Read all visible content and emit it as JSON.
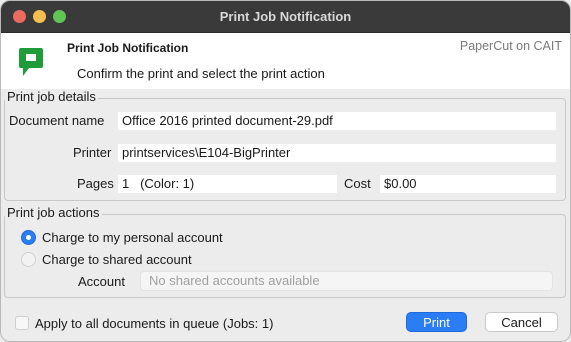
{
  "window": {
    "title": "Print Job Notification"
  },
  "header": {
    "title": "Print Job Notification",
    "brand": "PaperCut on CAIT",
    "subtitle": "Confirm the print and select the print action",
    "logo_color": "#1f9c3a"
  },
  "details": {
    "legend": "Print job details",
    "document_label": "Document name",
    "document_value": "Office 2016 printed document-29.pdf",
    "printer_label": "Printer",
    "printer_value": "printservices\\E104-BigPrinter",
    "pages_label": "Pages",
    "pages_value": "1   (Color: 1)",
    "cost_label": "Cost",
    "cost_value": "$0.00"
  },
  "actions": {
    "legend": "Print job actions",
    "personal_label": "Charge to my personal account",
    "personal_selected": true,
    "shared_label": "Charge to shared account",
    "shared_selected": false,
    "account_label": "Account",
    "account_placeholder": "No shared accounts available"
  },
  "footer": {
    "apply_all_label": "Apply to all documents in queue (Jobs: 1)",
    "apply_all_checked": false,
    "print_label": "Print",
    "cancel_label": "Cancel"
  },
  "colors": {
    "accent": "#2a7df5"
  }
}
